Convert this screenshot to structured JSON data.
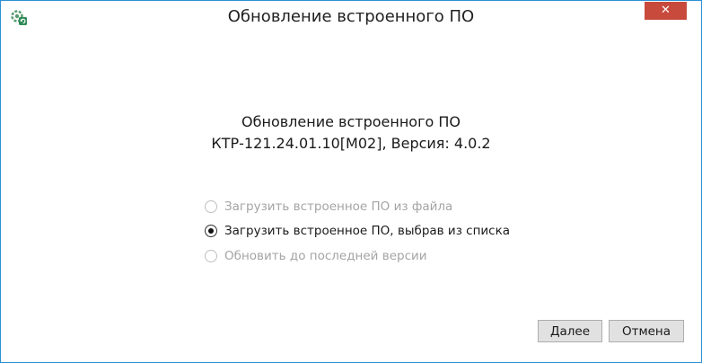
{
  "window": {
    "title": "Обновление встроенного ПО",
    "close_label": "✕"
  },
  "heading": {
    "line1": "Обновление встроенного ПО",
    "line2": "КТР-121.24.01.10[M02], Версия: 4.0.2"
  },
  "options": [
    {
      "label": "Загрузить встроенное ПО из файла",
      "enabled": false,
      "selected": false
    },
    {
      "label": "Загрузить встроенное ПО, выбрав из списка",
      "enabled": true,
      "selected": true
    },
    {
      "label": "Обновить до последней версии",
      "enabled": false,
      "selected": false
    }
  ],
  "buttons": {
    "next_label": "Далее",
    "cancel_label": "Отмена"
  },
  "colors": {
    "close_bg": "#c74a3c",
    "border": "#2b8fd6",
    "disabled_text": "#a4a4a4"
  },
  "icons": {
    "app": "gear-refresh-icon",
    "close": "close-icon"
  }
}
